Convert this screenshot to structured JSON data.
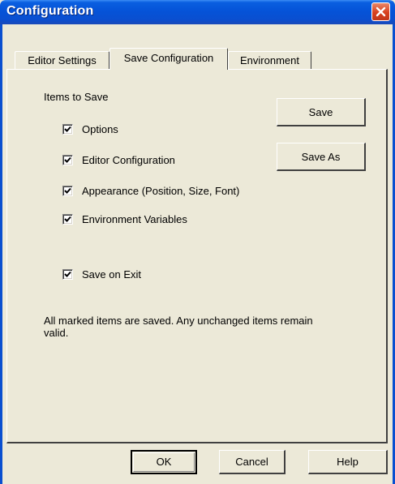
{
  "window": {
    "title": "Configuration"
  },
  "tabs": [
    {
      "label": "Editor Settings",
      "active": false
    },
    {
      "label": "Save Configuration",
      "active": true
    },
    {
      "label": "Environment",
      "active": false
    }
  ],
  "items_group": {
    "heading": "Items to Save",
    "items": [
      {
        "label": "Options",
        "checked": true
      },
      {
        "label": "Editor Configuration",
        "checked": true
      },
      {
        "label": "Appearance (Position, Size, Font)",
        "checked": true
      },
      {
        "label": "Environment Variables",
        "checked": true
      }
    ]
  },
  "save_on_exit": {
    "label": "Save on Exit",
    "checked": true
  },
  "side_buttons": {
    "save": "Save",
    "save_as": "Save As"
  },
  "info_text": "All marked items are saved. Any unchanged items remain valid.",
  "footer": {
    "ok": "OK",
    "cancel": "Cancel",
    "help": "Help"
  },
  "colors": {
    "titlebar": "#0553d8",
    "close_button": "#d8401e",
    "face": "#ece9d8"
  }
}
